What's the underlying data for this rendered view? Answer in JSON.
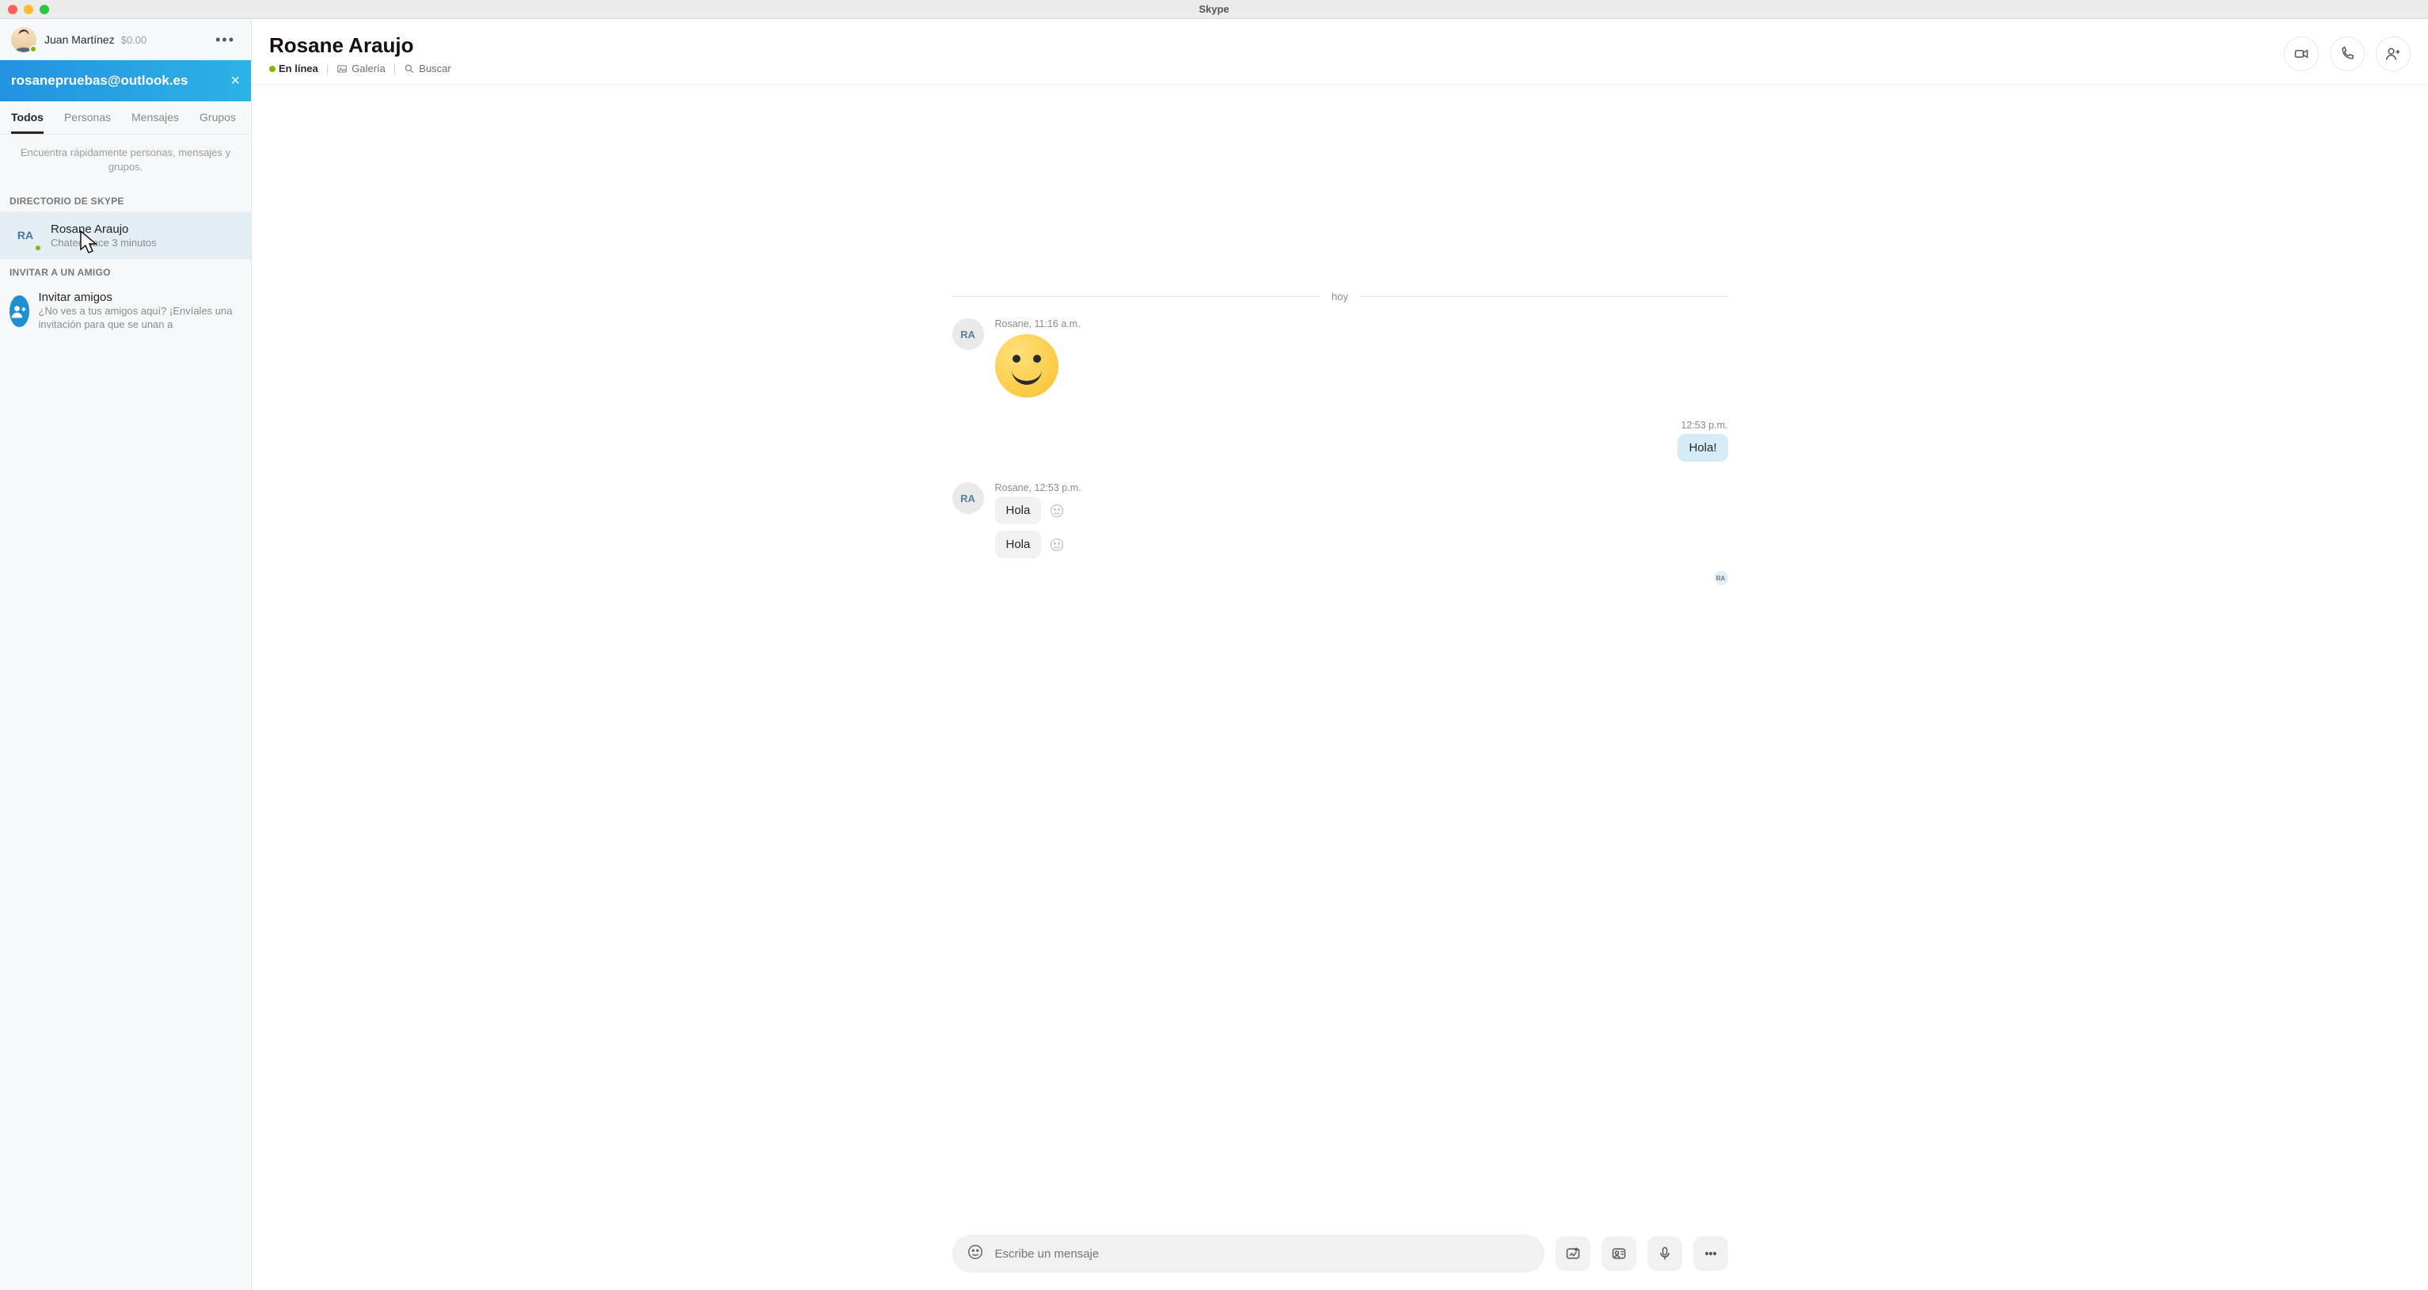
{
  "titlebar": {
    "app_name": "Skype"
  },
  "sidebar": {
    "profile": {
      "name": "Juan Martínez",
      "balance": "$0.00"
    },
    "search_text": "rosanepruebas@outlook.es",
    "tabs": {
      "todos": "Todos",
      "personas": "Personas",
      "mensajes": "Mensajes",
      "grupos": "Grupos"
    },
    "hint": "Encuentra rápidamente personas, mensajes y grupos.",
    "directory_label": "DIRECTORIO DE SKYPE",
    "contact": {
      "initials": "RA",
      "name": "Rosane Araujo",
      "sub": "Chateó hace 3 minutos"
    },
    "invite_label": "INVITAR A UN AMIGO",
    "invite": {
      "title": "Invitar amigos",
      "sub": "¿No ves a tus amigos aquí? ¡Envíales una invitación para que se unan a"
    }
  },
  "chat": {
    "title": "Rosane Araujo",
    "status": "En línea",
    "gallery": "Galería",
    "search": "Buscar",
    "day_label": "hoy",
    "msg1_meta": "Rosane, 11:16 a.m.",
    "msg1_avatar": "RA",
    "msg2_meta": "12:53 p.m.",
    "msg2_text": "Hola!",
    "msg3_meta": "Rosane, 12:53 p.m.",
    "msg3_avatar": "RA",
    "msg3_b1": "Hola",
    "msg3_b2": "Hola",
    "receipt_initials": "RA",
    "composer_placeholder": "Escribe un mensaje"
  }
}
